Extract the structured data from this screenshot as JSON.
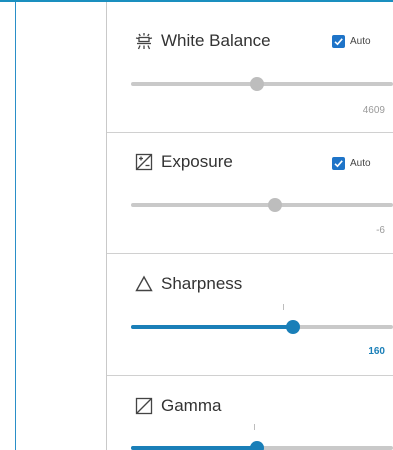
{
  "colors": {
    "accent_blue": "#1a7fb8",
    "checkbox_blue": "#1e74c8",
    "track_gray": "#c9c9c9",
    "thumb_gray": "#bdbdbd",
    "value_gray": "#9a9a9a",
    "value_blue": "#1a7fb8"
  },
  "controls": [
    {
      "label": "White Balance",
      "icon": "white-balance-icon",
      "auto_label": "Auto",
      "auto_checked": true,
      "value": "4609",
      "position": 0.48,
      "active": false
    },
    {
      "label": "Exposure",
      "icon": "exposure-icon",
      "auto_label": "Auto",
      "auto_checked": true,
      "value": "-6",
      "position": 0.55,
      "active": false
    },
    {
      "label": "Sharpness",
      "icon": "sharpness-triangle-icon",
      "value": "160",
      "position": 0.62,
      "default_position": 0.58,
      "active": true
    },
    {
      "label": "Gamma",
      "icon": "gamma-icon",
      "position": 0.48,
      "default_position": 0.47,
      "active": true
    }
  ]
}
